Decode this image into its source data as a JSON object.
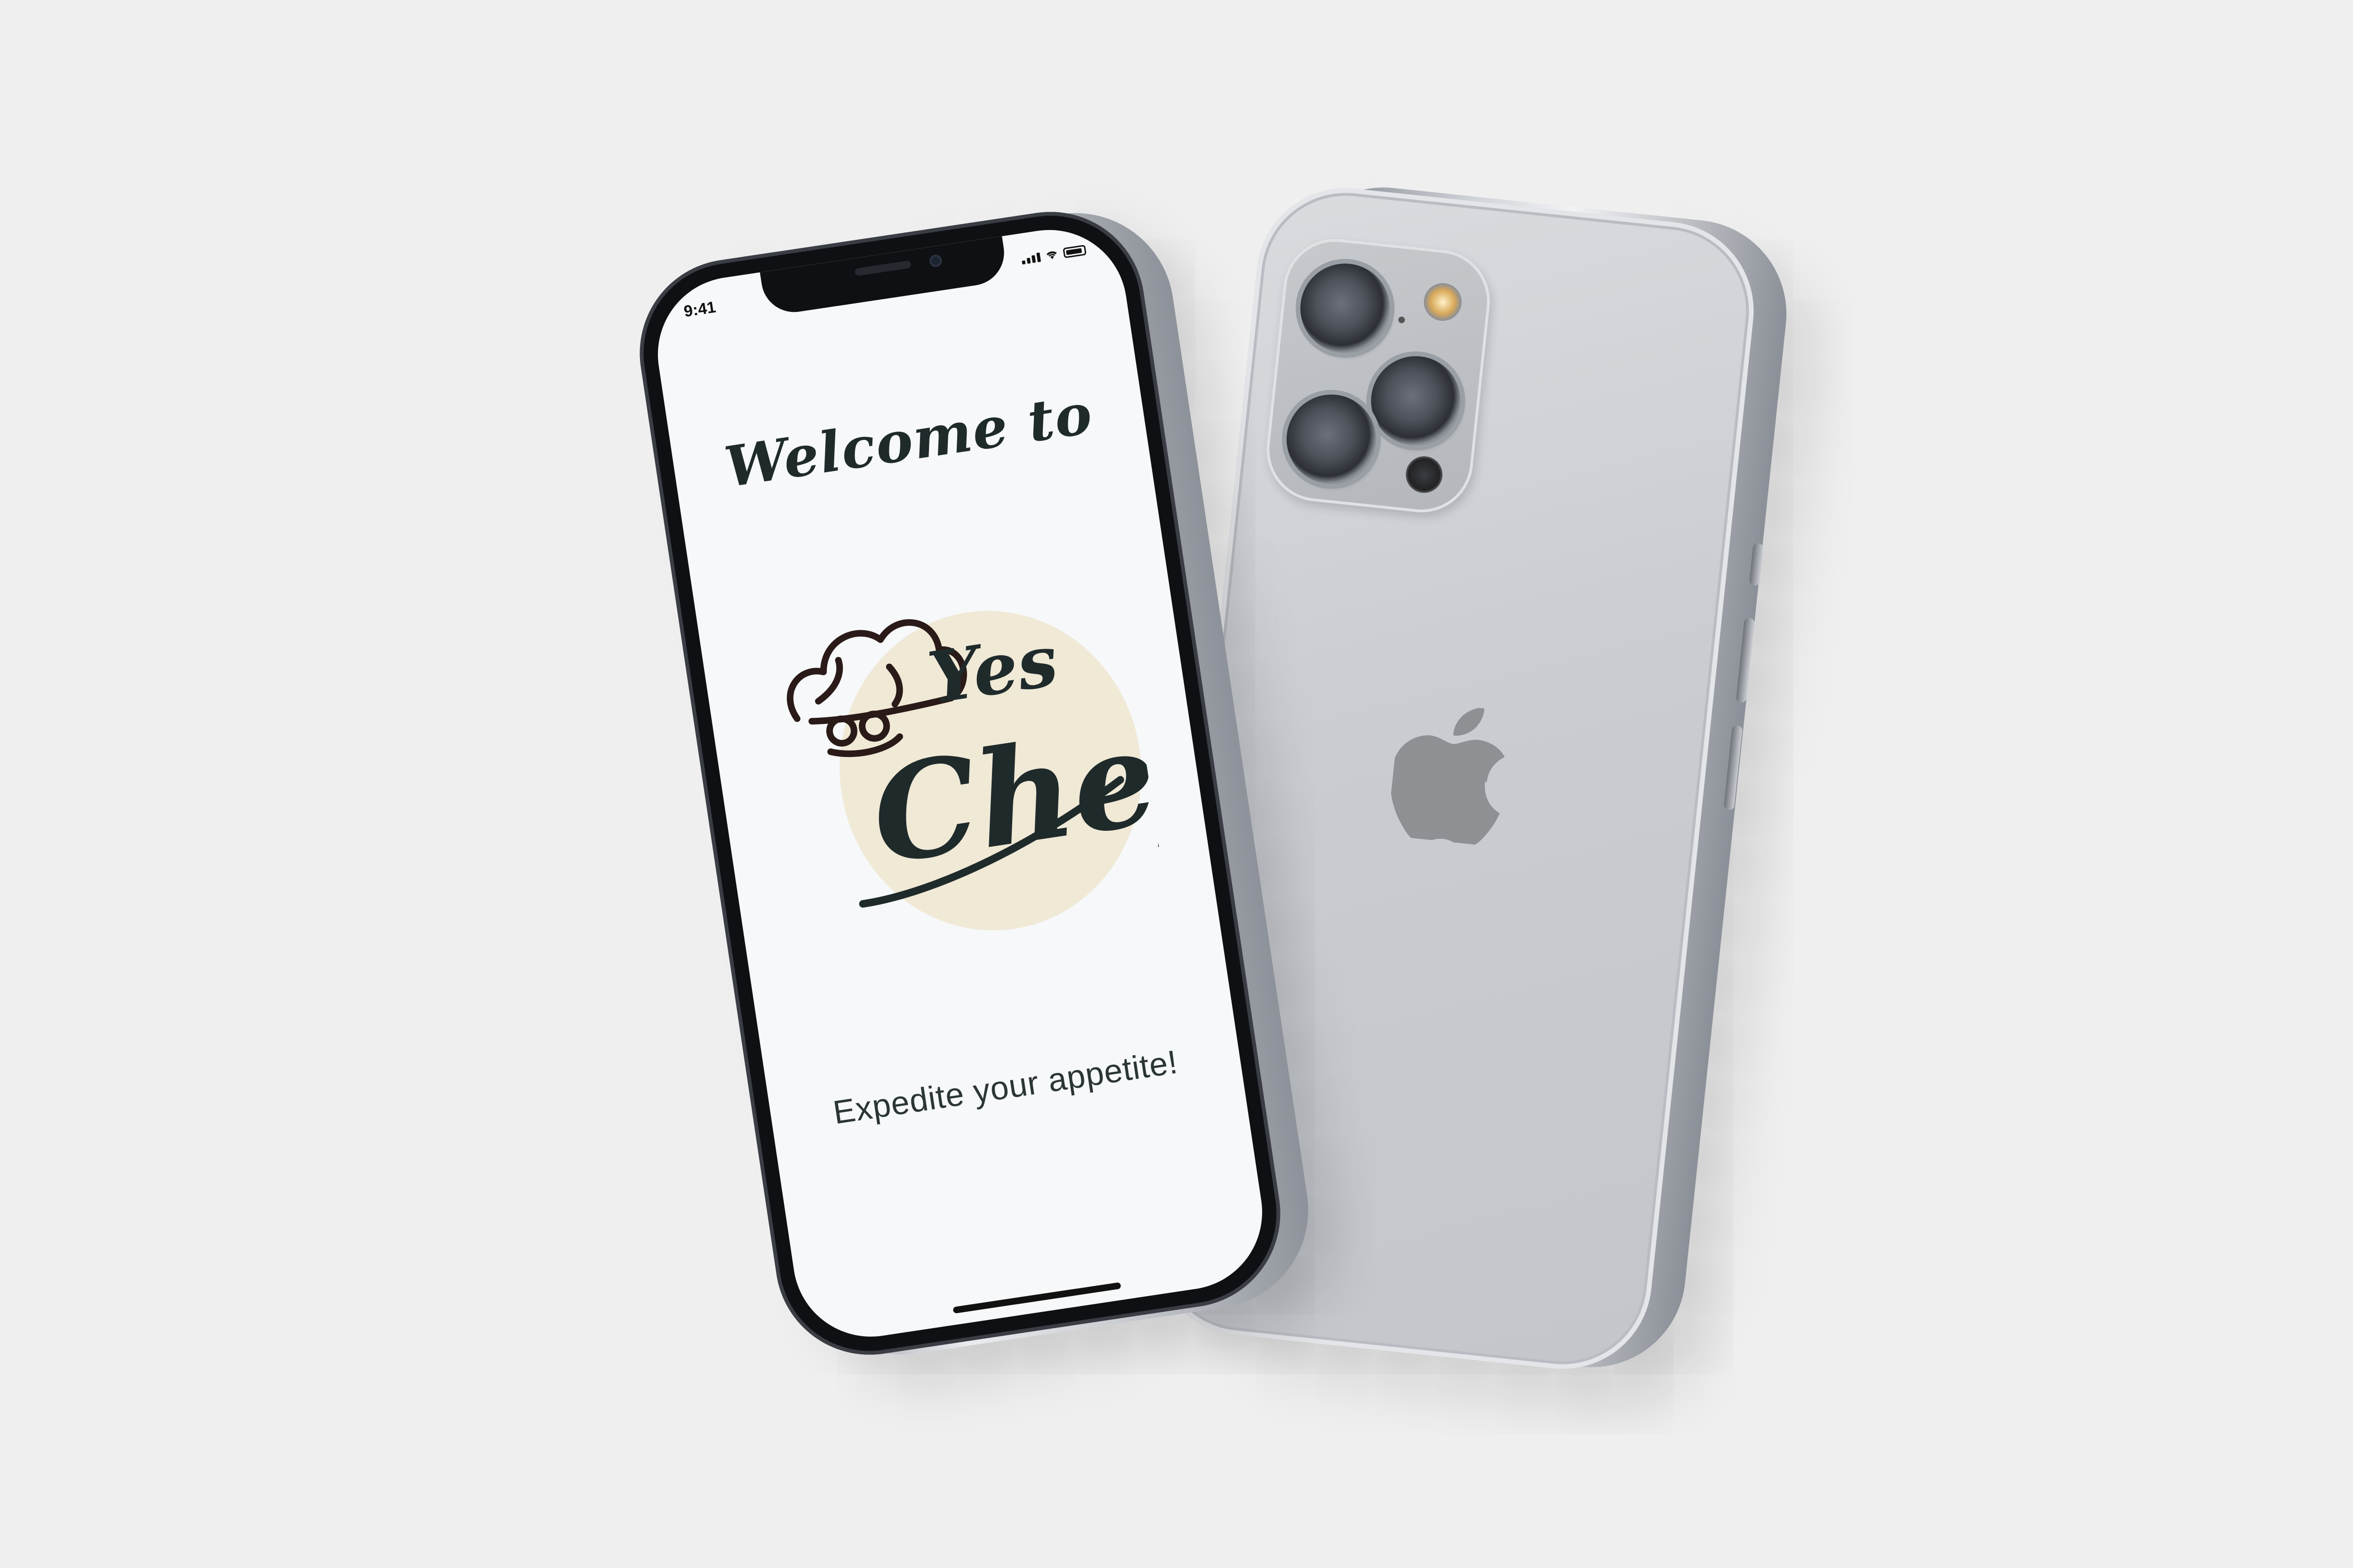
{
  "scene": {
    "background_color": "#efefef",
    "front_phone": {
      "status_bar": {
        "time": "9:41",
        "icons": [
          "signal-icon",
          "wifi-icon",
          "battery-icon"
        ]
      },
      "screen": {
        "title": "Welcome to",
        "logo": {
          "text_line1": "Yes",
          "text_line2": "Chef",
          "circle_color": "#f0e9d6",
          "icon": "chef-hat-icon"
        },
        "tagline": "Expedite your appetite!"
      },
      "colors": {
        "screen_bg": "#f6f8fa",
        "text": "#1f2a2b"
      }
    },
    "back_phone": {
      "color": "#c9ccd1",
      "icon": "apple-logo-icon",
      "camera": [
        "lens-icon",
        "lens-icon",
        "lens-icon",
        "flash-icon",
        "lidar-icon"
      ]
    }
  }
}
